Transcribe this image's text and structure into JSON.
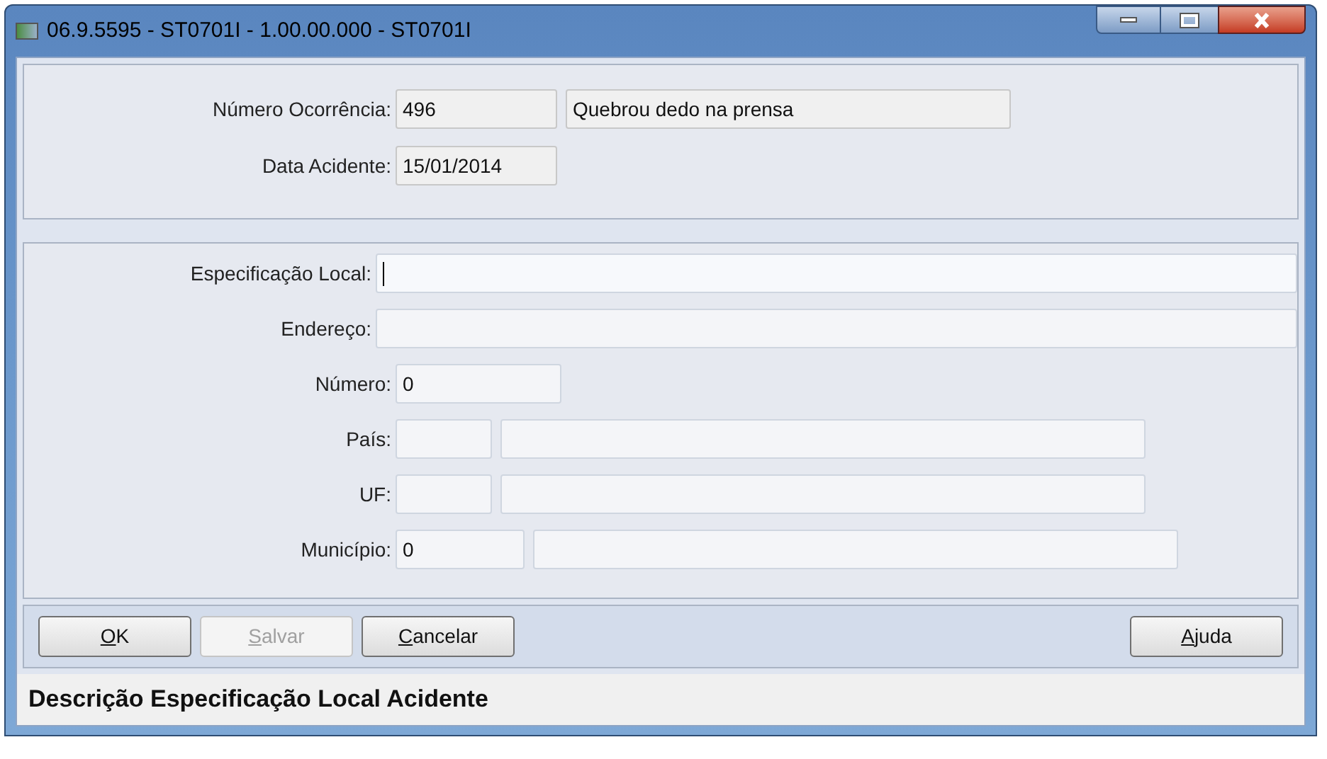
{
  "window": {
    "title": "06.9.5595 - ST0701I - 1.00.00.000 - ST0701I"
  },
  "header_panel": {
    "rows": [
      {
        "label": "Número Ocorrência:",
        "fields": [
          {
            "value": "496"
          },
          {
            "value": "Quebrou dedo na prensa"
          }
        ]
      },
      {
        "label": "Data Acidente:",
        "fields": [
          {
            "value": "15/01/2014"
          }
        ]
      }
    ]
  },
  "detail_panel": {
    "rows": [
      {
        "label": "Especificação Local:",
        "fields": [
          {
            "focused": true
          }
        ]
      },
      {
        "label": "Endereço:",
        "fields": [
          {
            "focused": false
          }
        ]
      },
      {
        "label": "Número:",
        "fields": [
          {
            "value": "0",
            "focused": false
          }
        ]
      },
      {
        "label": "País:",
        "fields": [
          {
            "focused": false
          },
          {
            "focused": false
          }
        ]
      },
      {
        "label": "UF:",
        "fields": [
          {
            "focused": false
          },
          {
            "focused": false
          }
        ]
      },
      {
        "label": "Município:",
        "fields": [
          {
            "value": "0",
            "focused": false
          },
          {
            "focused": false
          }
        ]
      }
    ]
  },
  "buttons_left": [
    {
      "label": "OK",
      "disabled": false
    },
    {
      "label": "Salvar",
      "disabled": true
    },
    {
      "label": "Cancelar",
      "disabled": false
    }
  ],
  "buttons_right": [
    {
      "label": "Ajuda",
      "disabled": false
    }
  ],
  "status_bar": {
    "text": "Descrição Especificação Local Acidente"
  }
}
